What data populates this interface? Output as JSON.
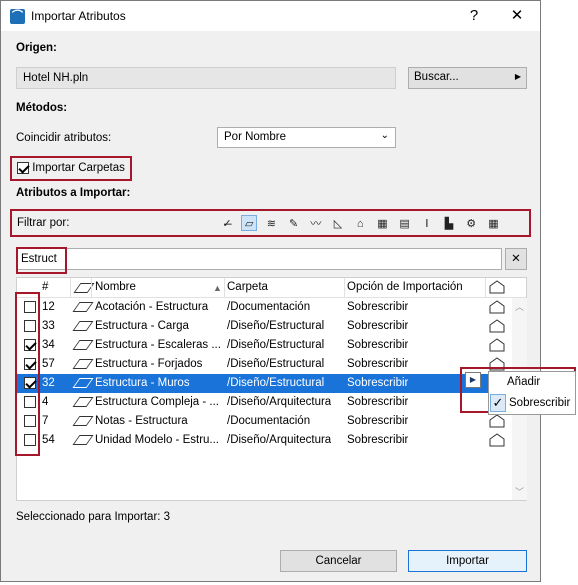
{
  "window": {
    "title": "Importar Atributos",
    "help_btn": "?",
    "close_btn": "✕",
    "app_glyph": "⌒"
  },
  "origen": {
    "label": "Origen:",
    "file": "Hotel NH.pln",
    "browse": "Buscar..."
  },
  "metodos": {
    "label": "Métodos:",
    "match_label": "Coincidir atributos:",
    "match_value": "Por Nombre"
  },
  "import_folders": {
    "label": "Importar Carpetas",
    "checked": true
  },
  "atributos": {
    "label": "Atributos a Importar:",
    "filter_label": "Filtrar por:",
    "filter_icons": [
      "deselect-all-icon",
      "fill-icon",
      "composite-icon",
      "pen-icon",
      "line-icon",
      "surface-icon",
      "zone-icon",
      "profile-icon",
      "building-material-icon",
      "layer-icon",
      "markup-icon",
      "mep-icon",
      "table-icon"
    ]
  },
  "search": {
    "value": "Estruct",
    "clear": "✕"
  },
  "columns": {
    "num": "#",
    "name": "Nombre",
    "folder": "Carpeta",
    "option": "Opción de Importación"
  },
  "rows": [
    {
      "checked": false,
      "num": "12",
      "name": "Acotación - Estructura",
      "folder": "/Documentación",
      "option": "Sobrescribir",
      "selected": false
    },
    {
      "checked": false,
      "num": "33",
      "name": "Estructura - Carga",
      "folder": "/Diseño/Estructural",
      "option": "Sobrescribir",
      "selected": false
    },
    {
      "checked": true,
      "num": "34",
      "name": "Estructura - Escaleras ...",
      "folder": "/Diseño/Estructural",
      "option": "Sobrescribir",
      "selected": false
    },
    {
      "checked": true,
      "num": "57",
      "name": "Estructura - Forjados",
      "folder": "/Diseño/Estructural",
      "option": "Sobrescribir",
      "selected": false
    },
    {
      "checked": true,
      "num": "32",
      "name": "Estructura - Muros",
      "folder": "/Diseño/Estructural",
      "option": "Sobrescribir",
      "selected": true
    },
    {
      "checked": false,
      "num": "4",
      "name": "Estructura Compleja - ...",
      "folder": "/Diseño/Arquitectura",
      "option": "Sobrescribir",
      "selected": false
    },
    {
      "checked": false,
      "num": "7",
      "name": "Notas - Estructura",
      "folder": "/Documentación",
      "option": "Sobrescribir",
      "selected": false
    },
    {
      "checked": false,
      "num": "54",
      "name": "Unidad Modelo - Estru...",
      "folder": "/Diseño/Arquitectura",
      "option": "Sobrescribir",
      "selected": false
    }
  ],
  "popup": {
    "add": "Añadir",
    "overwrite": "Sobrescribir"
  },
  "status": "Seleccionado para Importar: 3",
  "buttons": {
    "cancel": "Cancelar",
    "import": "Importar"
  },
  "colors": {
    "accent": "#1a73d9",
    "highlight_box": "#a6172c"
  }
}
